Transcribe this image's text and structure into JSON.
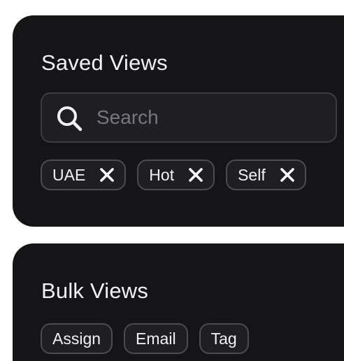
{
  "saved_views": {
    "title": "Saved Views",
    "search": {
      "placeholder": "Search",
      "value": ""
    },
    "chips": [
      {
        "label": "UAE"
      },
      {
        "label": "Hot"
      },
      {
        "label": "Self"
      }
    ]
  },
  "bulk_views": {
    "title": "Bulk Views",
    "actions": [
      {
        "label": "Assign"
      },
      {
        "label": "Email"
      },
      {
        "label": "Tag"
      }
    ]
  },
  "icons": {
    "search": "search-icon",
    "remove": "close-icon"
  },
  "colors": {
    "panel_background": "#151518",
    "text": "#f2f2f4",
    "placeholder": "#76767e",
    "border": "#4b4b52"
  }
}
